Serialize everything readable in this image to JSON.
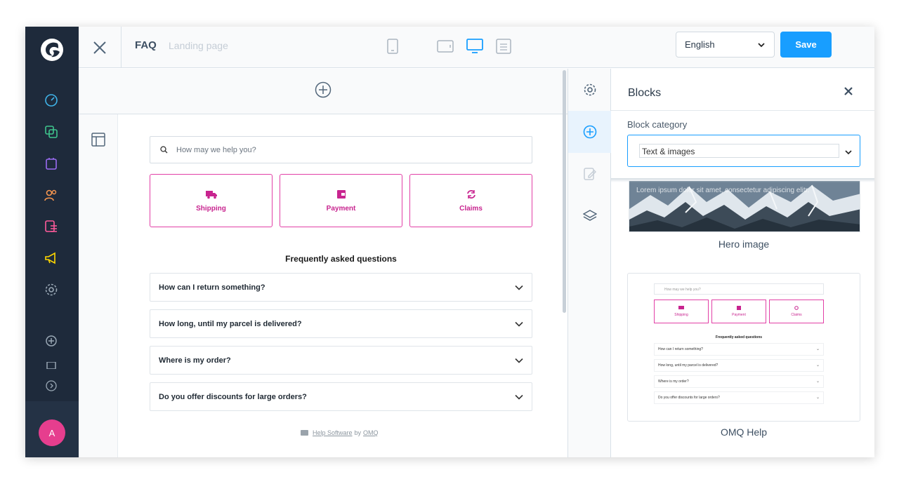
{
  "topbar": {
    "title": "FAQ",
    "subtitle": "Landing page",
    "language": "English",
    "save_label": "Save"
  },
  "admin_nav": {
    "avatar_initial": "A",
    "icons": [
      "dashboard-icon",
      "catalogue-icon",
      "orders-icon",
      "customers-icon",
      "content-icon",
      "marketing-icon",
      "settings-icon",
      "add-icon",
      "extensions-icon",
      "expand-icon"
    ]
  },
  "canvas": {
    "search_placeholder": "How may we help you?",
    "tiles": [
      {
        "label": "Shipping",
        "icon": "truck-icon"
      },
      {
        "label": "Payment",
        "icon": "wallet-icon"
      },
      {
        "label": "Claims",
        "icon": "refresh-icon"
      }
    ],
    "faq_heading": "Frequently asked questions",
    "faq_items": [
      "How can I return something?",
      "How long, until my parcel is delivered?",
      "Where is my order?",
      "Do you offer discounts for large orders?"
    ],
    "powered_link": "Help Software",
    "powered_by": "by",
    "powered_company": "OMQ"
  },
  "panel": {
    "title": "Blocks",
    "category_label": "Block category",
    "category_value": "Text & images",
    "hero_overlay": "Lorem ipsum dolor sit amet, consectetur adipiscing elitr.",
    "hero_caption": "Hero image",
    "omq_caption": "OMQ Help",
    "mini": {
      "search": "How may we help you?",
      "tiles": [
        "Shipping",
        "Payment",
        "Claims"
      ],
      "heading": "Frequently asked questions",
      "items": [
        "How can I return something?",
        "How long, until my parcel is delivered?",
        "Where is my order?",
        "Do you offer discounts for large orders?"
      ]
    }
  },
  "colors": {
    "sidebar": "#1e2a3b",
    "accent": "#189eff",
    "pink": "#e23fa6"
  }
}
